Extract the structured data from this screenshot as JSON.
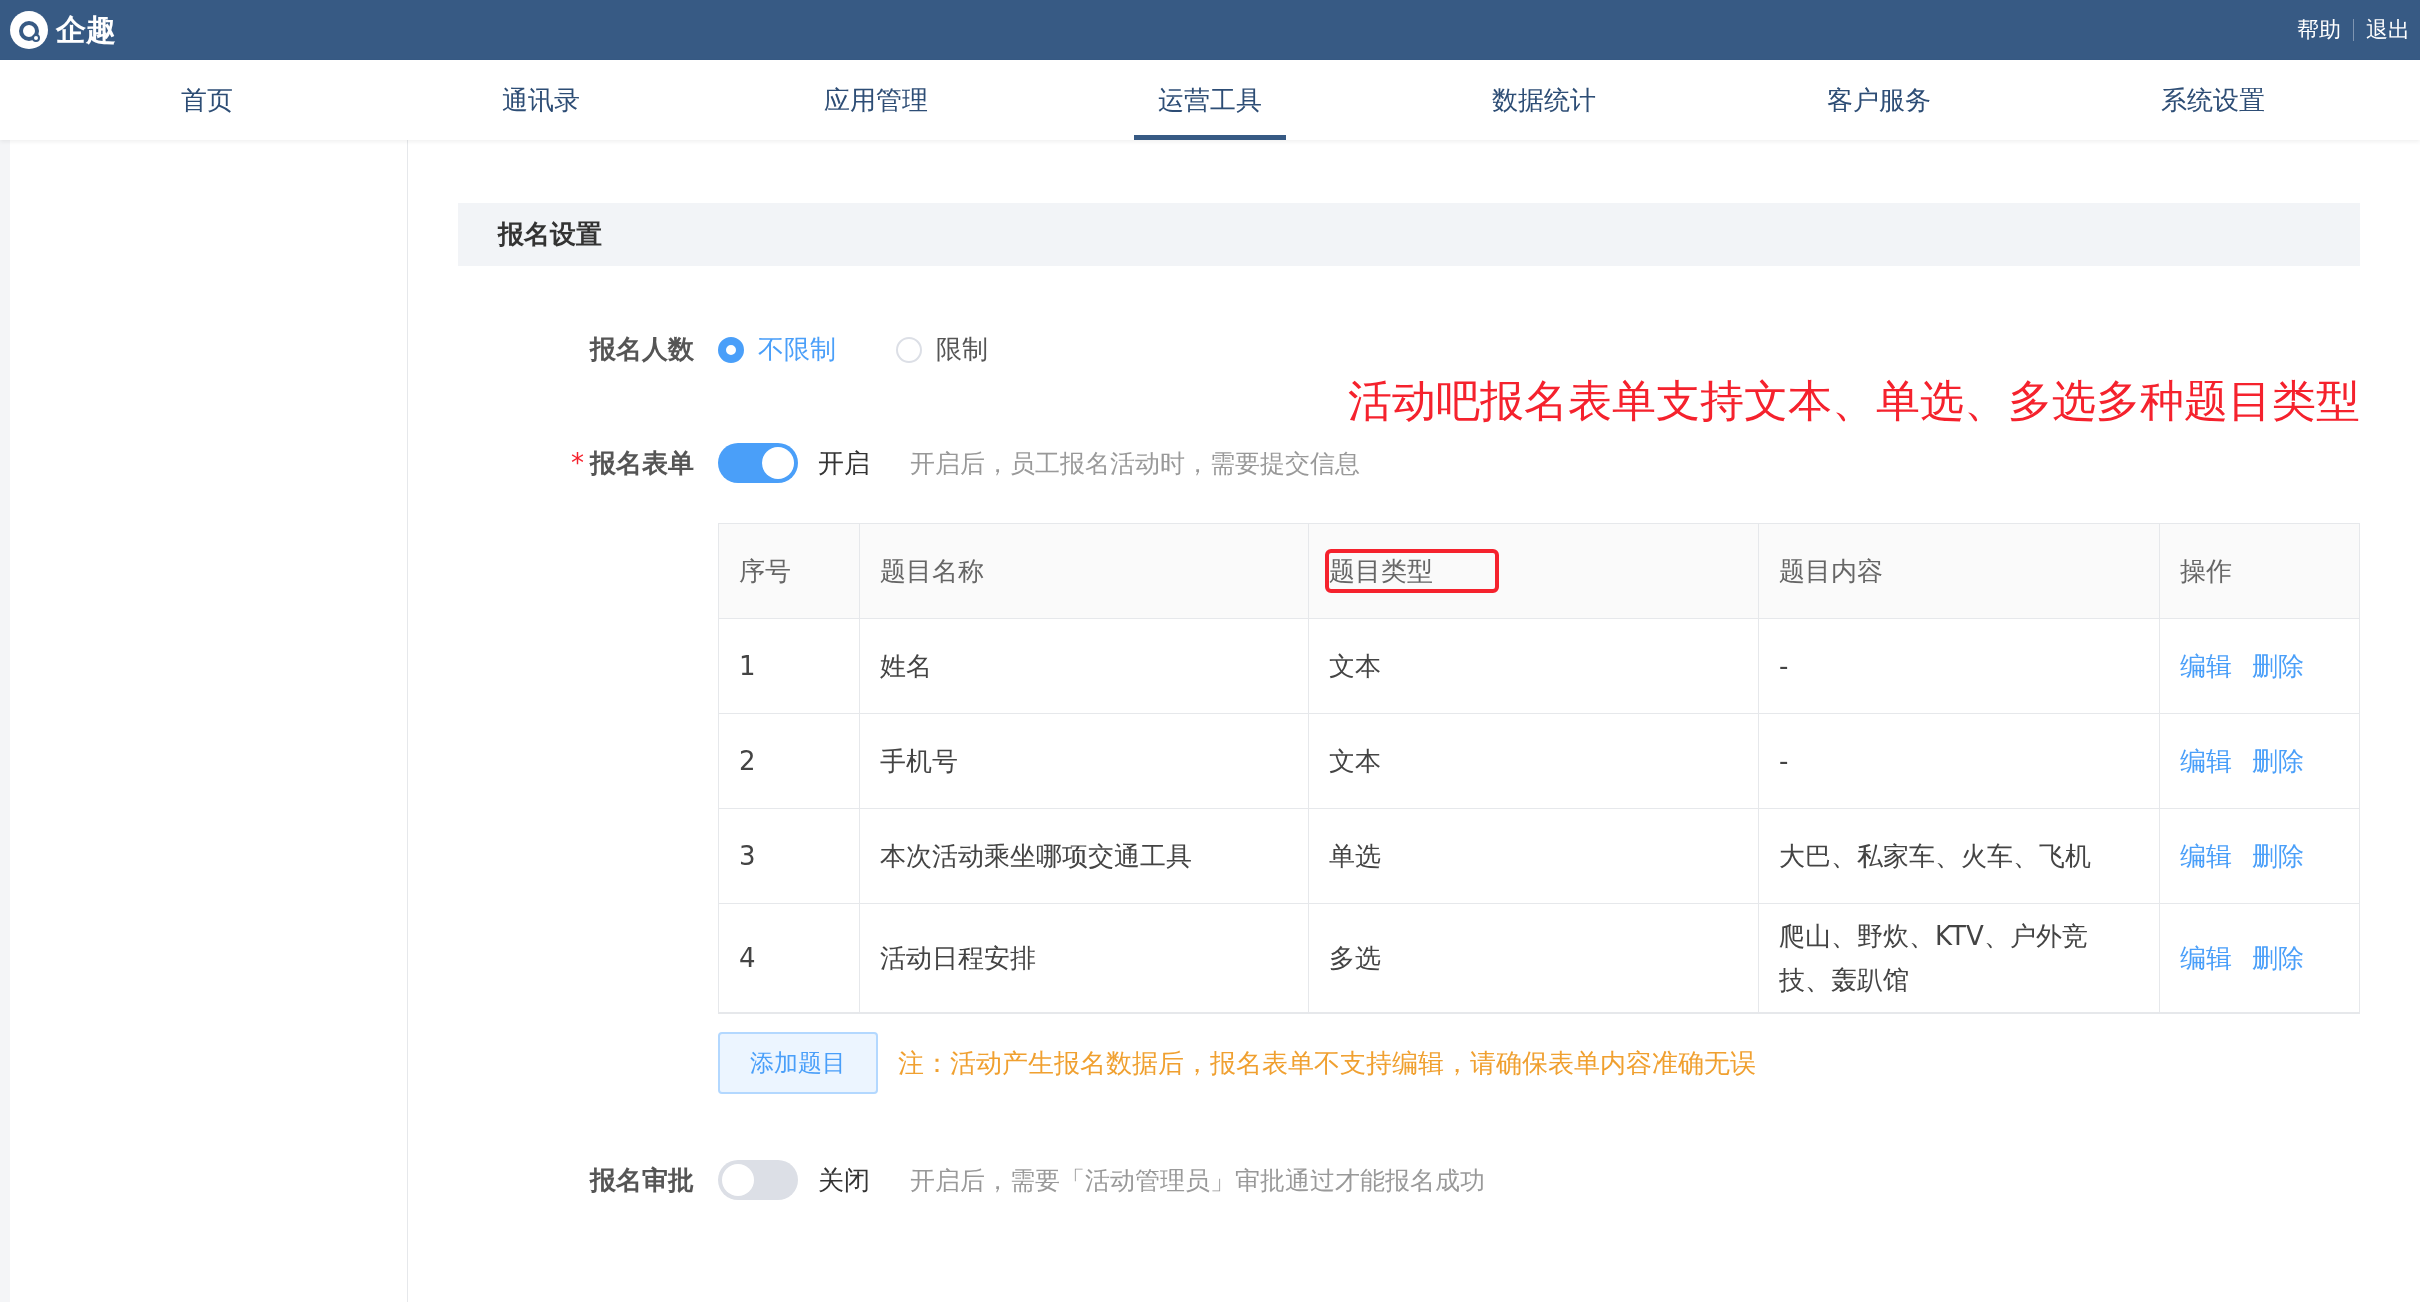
{
  "header": {
    "logo_text": "企趣",
    "links": [
      "帮助",
      "退出"
    ]
  },
  "nav": {
    "tabs": [
      {
        "label": "首页",
        "selected": false
      },
      {
        "label": "通讯录",
        "selected": false
      },
      {
        "label": "应用管理",
        "selected": false
      },
      {
        "label": "运营工具",
        "selected": true
      },
      {
        "label": "数据统计",
        "selected": false
      },
      {
        "label": "客户服务",
        "selected": false
      },
      {
        "label": "系统设置",
        "selected": false
      }
    ]
  },
  "section": {
    "title": "报名设置"
  },
  "limit_field": {
    "label": "报名人数",
    "options": [
      {
        "label": "不限制",
        "selected": true
      },
      {
        "label": "限制",
        "selected": false
      }
    ]
  },
  "annotation": "活动吧报名表单支持文本、单选、多选多种题目类型",
  "form_field": {
    "label": "报名表单",
    "required_mark": "*",
    "on": true,
    "state_text": "开启",
    "hint": "开启后，员工报名活动时，需要提交信息"
  },
  "table": {
    "columns": [
      {
        "label": "序号",
        "highlighted": false
      },
      {
        "label": "题目名称",
        "highlighted": false
      },
      {
        "label": "题目类型",
        "highlighted": true
      },
      {
        "label": "题目内容",
        "highlighted": false
      },
      {
        "label": "操作",
        "highlighted": false
      }
    ],
    "rows": [
      {
        "index": "1",
        "name": "姓名",
        "type": "文本",
        "content": "-",
        "actions": [
          "编辑",
          "删除"
        ]
      },
      {
        "index": "2",
        "name": "手机号",
        "type": "文本",
        "content": "-",
        "actions": [
          "编辑",
          "删除"
        ]
      },
      {
        "index": "3",
        "name": "本次活动乘坐哪项交通工具",
        "type": "单选",
        "content": "大巴、私家车、火车、飞机",
        "actions": [
          "编辑",
          "删除"
        ]
      },
      {
        "index": "4",
        "name": "活动日程安排",
        "type": "多选",
        "content": "爬山、野炊、KTV、户外竞技、轰趴馆",
        "actions": [
          "编辑",
          "删除"
        ]
      }
    ]
  },
  "add_button": "添加题目",
  "note": "注：活动产生报名数据后，报名表单不支持编辑，请确保表单内容准确无误",
  "approval_field": {
    "label": "报名审批",
    "on": false,
    "state_text": "关闭",
    "hint": "开启后，需要「活动管理员」审批通过才能报名成功"
  }
}
